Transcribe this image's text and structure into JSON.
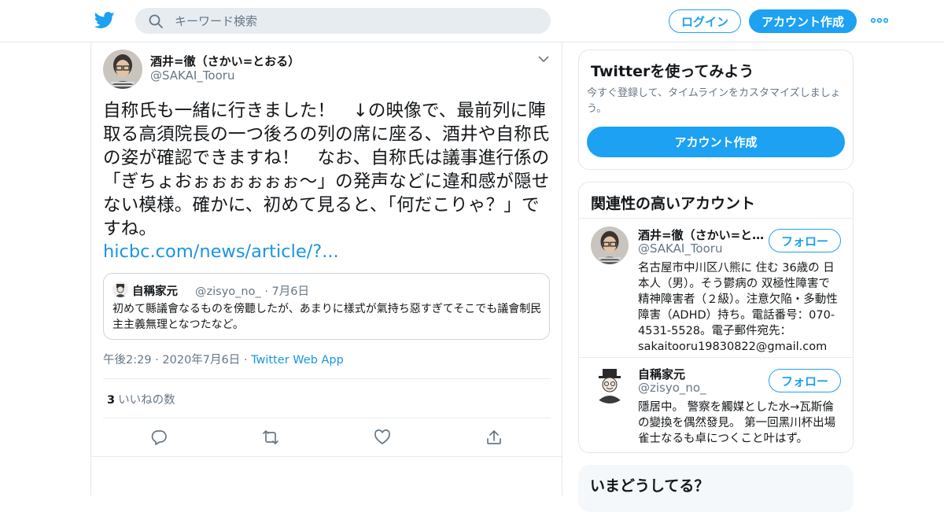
{
  "header": {
    "search_placeholder": "キーワード検索",
    "login_label": "ログイン",
    "signup_label": "アカウント作成",
    "brand_color": "#1da1f2"
  },
  "tweet": {
    "author_name": "酒井=徹（さかい=とおる）",
    "author_handle": "@SAKAI_Tooru",
    "text": "自称氏も一緒に行きました！　↓の映像で、最前列に陣取る高須院長の一つ後ろの列の席に座る、酒井や自称氏の姿が確認できますね！　なお、自称氏は議事進行係の「ぎちょおぉぉぉぉぉぉ～」の発声などに違和感が隠せない模様。確かに、初めて見ると、「何だこりゃ？」ですね。",
    "link": "hicbc.com/news/article/?...",
    "quote": {
      "name": "自稱家元",
      "handle": "@zisyo_no_ · 7月6日",
      "text": "初めて縣議會なるものを傍聽したが、あまりに樣式が氣持ち惡すぎてそこでも議會制民主主義無理となつたなど。"
    },
    "time": "午後2:29",
    "date": "2020年7月6日",
    "app": "Twitter Web App",
    "like_count": "3",
    "like_label": "いいねの数"
  },
  "sidebar": {
    "signup_card": {
      "title": "Twitterを使ってみよう",
      "description": "今すぐ登録して、タイムラインをカスタマイズしましょう。",
      "button_label": "アカウント作成"
    },
    "related": {
      "title": "関連性の高いアカウント",
      "accounts": [
        {
          "name": "酒井=徹（さかい=と…",
          "handle": "@SAKAI_Tooru",
          "follow_label": "フォロー",
          "bio": "名古屋市中川区八熊に 住む 36歳の 日本人（男）。そう鬱病の 双極性障害で 精神障害者（２級）。注意欠陥・多動性障害（ADHD）持ち。電話番号：070-4531-5528。電子郵件宛先：sakaitooru19830822@gmail.com"
        },
        {
          "name": "自稱家元",
          "handle": "@zisyo_no_",
          "follow_label": "フォロー",
          "bio": "隱居中。 警察を觸媒とした水→瓦斯倫の變換を偶然發見。 第一回黑川杯出場雀士なるも卓につくこと叶はず。"
        }
      ]
    },
    "trends_title": "いまどうしてる？"
  }
}
